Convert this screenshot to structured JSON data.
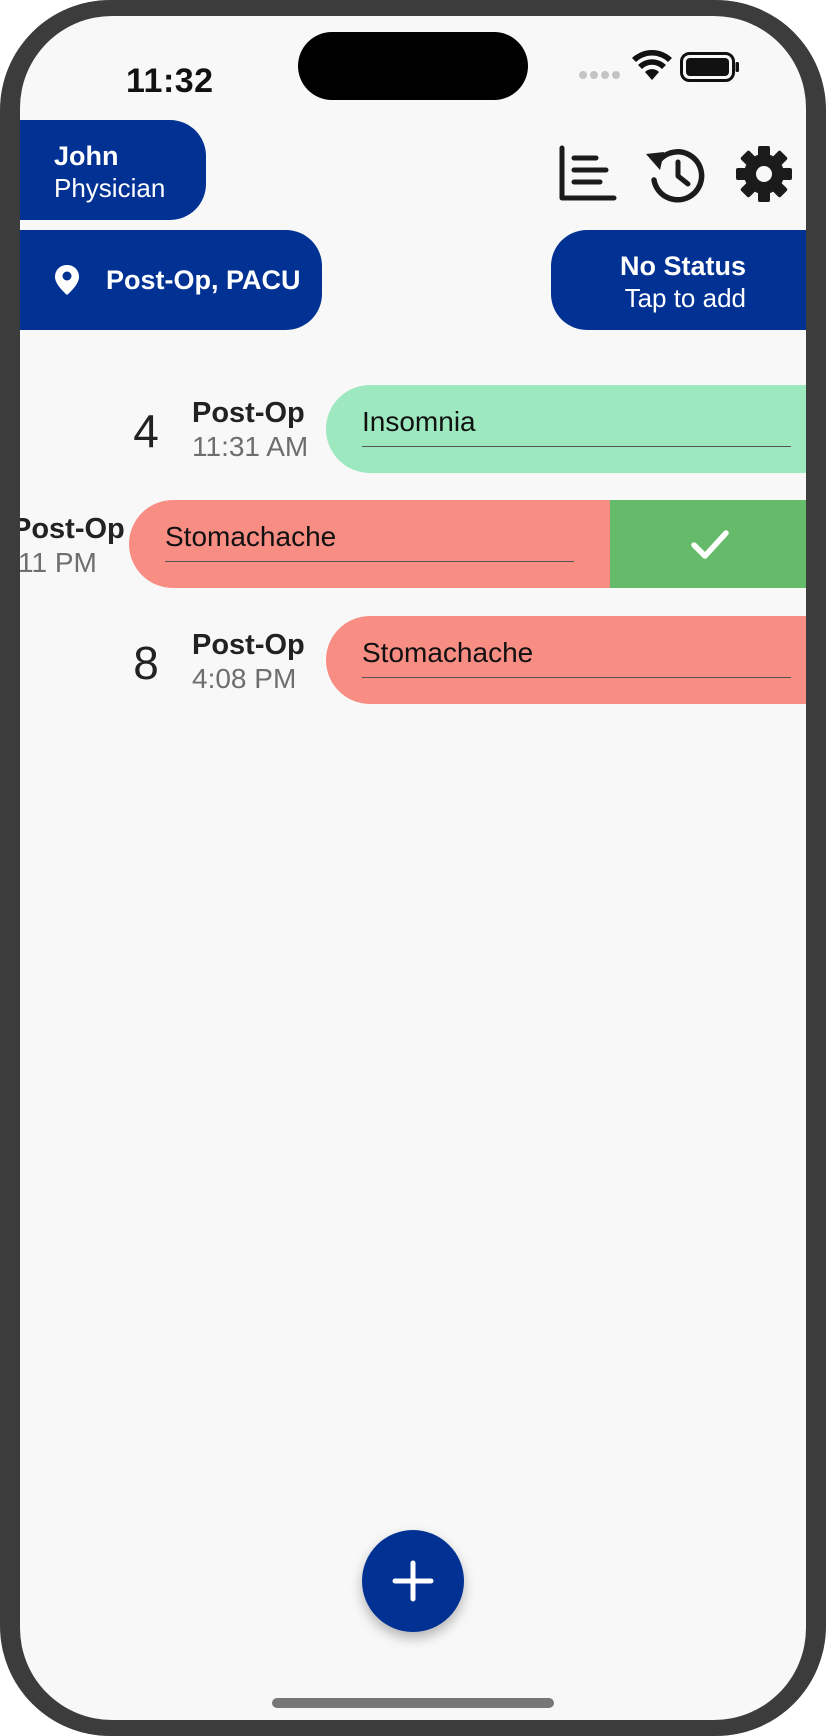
{
  "status_bar": {
    "time": "11:32",
    "icons": [
      "signal-dots-icon",
      "wifi-icon",
      "battery-icon"
    ]
  },
  "header": {
    "user": {
      "name": "John",
      "role": "Physician"
    },
    "icons": [
      "stats-list-icon",
      "history-icon",
      "settings-gear-icon"
    ],
    "location": {
      "icon": "location-pin-icon",
      "label": "Post-Op, PACU"
    },
    "status": {
      "title": "No Status",
      "subtitle": "Tap to add"
    }
  },
  "entries": [
    {
      "number": "4",
      "location": "Post-Op",
      "time": "11:31 AM",
      "symptom": "Insomnia",
      "color": "#9de8bf"
    },
    {
      "number": "",
      "location": "Post-Op",
      "time": "11 PM",
      "symptom": "Stomachache",
      "color": "#f88d84",
      "swiped": true,
      "action_icon": "check-icon",
      "action_color": "#66bb6a"
    },
    {
      "number": "8",
      "location": "Post-Op",
      "time": "4:08 PM",
      "symptom": "Stomachache",
      "color": "#f88d84"
    }
  ],
  "fab": {
    "icon": "plus-icon"
  },
  "colors": {
    "primary": "#023194",
    "background": "#f8f8f8",
    "frame": "#3c3c3c"
  }
}
